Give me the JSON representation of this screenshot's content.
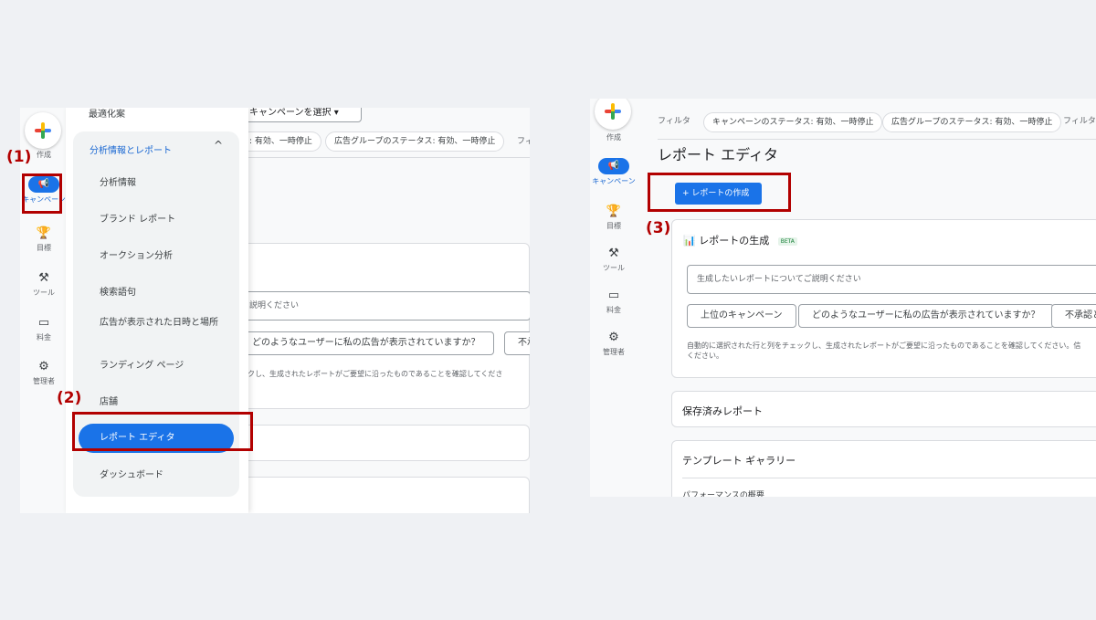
{
  "annotations": {
    "step1": "(1)",
    "step2": "(2)",
    "step3": "(3)"
  },
  "nav": {
    "create": "作成",
    "campaigns": "キャンペーン",
    "goals": "目標",
    "tools": "ツール",
    "billing": "料金",
    "admin": "管理者"
  },
  "left": {
    "menu_top": "最適化案",
    "group_label": "分析情報とレポート",
    "items": [
      "分析情報",
      "ブランド レポート",
      "オークション分析",
      "検索語句",
      "広告が表示された日時と場所",
      "ランディング ページ",
      "店舗",
      "レポート エディタ",
      "ダッシュボード"
    ],
    "select_campaign": "キャンペーンを選択",
    "chip_status": ": 有効、一時停止",
    "chip_adgroup": "広告グループのステータス: 有効、一時停止",
    "chip_filter": "フィ",
    "describe_partial": "説明ください",
    "question_chip": "どのようなユーザーに私の広告が表示されていますか？",
    "chip_unapproved_partial": "不承",
    "note_partial": "クし、生成されたレポートがご要望に沿ったものであることを確認してくださ"
  },
  "right": {
    "filter_label": "フィルタ",
    "chip_campaign_status": "キャンペーンのステータス: 有効、一時停止",
    "chip_adgroup_status": "広告グループのステータス: 有効、一時停止",
    "filter_label_2": "フィルタ",
    "title": "レポート エディタ",
    "create_button": "+ レポートの作成",
    "gen_title": "レポートの生成",
    "beta": "BETA",
    "input_placeholder": "生成したいレポートについてご説明ください",
    "suggestions": [
      "上位のキャンペーン",
      "どのようなユーザーに私の広告が表示されていますか？",
      "不承認と"
    ],
    "note": "自動的に選択された行と列をチェックし、生成されたレポートがご要望に沿ったものであることを確認してください。信",
    "note_line2": "ください。",
    "saved_reports": "保存済みレポート",
    "template_gallery": "テンプレート ギャラリー",
    "performance_partial": "パフォーマンスの概要"
  }
}
